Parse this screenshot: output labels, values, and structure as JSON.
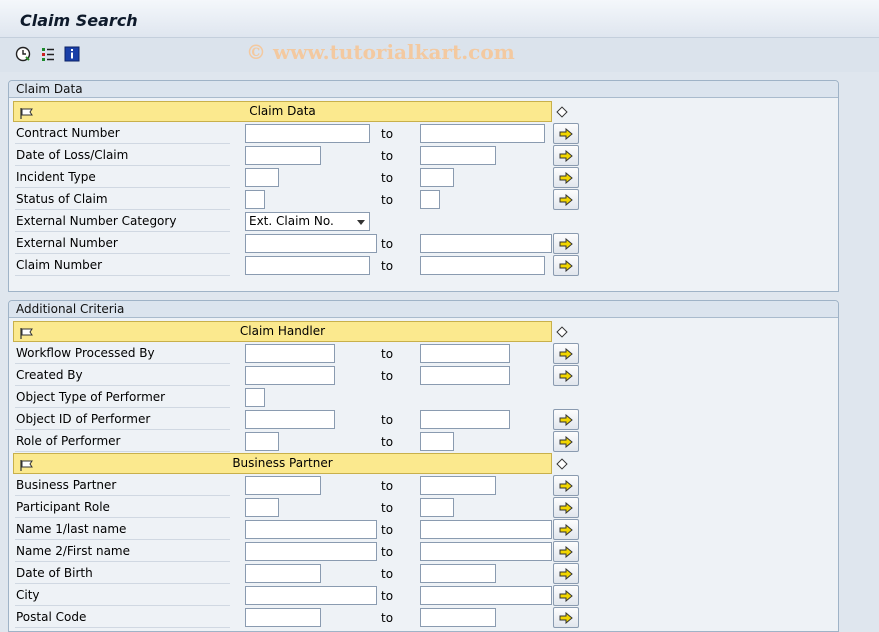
{
  "app": {
    "title": "Claim Search",
    "watermark": "© www.tutorialkart.com"
  },
  "toolbar": {
    "icons": [
      "execute-clock-icon",
      "selection-options-icon",
      "info-icon"
    ]
  },
  "sections": {
    "claim_data": {
      "title": "Claim Data",
      "block_title": "Claim Data",
      "rows": [
        {
          "label": "Contract Number"
        },
        {
          "label": "Date of Loss/Claim"
        },
        {
          "label": "Incident Type"
        },
        {
          "label": "Status of Claim"
        },
        {
          "label": "External Number Category",
          "value": "Ext. Claim No."
        },
        {
          "label": "External Number"
        },
        {
          "label": "Claim Number"
        }
      ]
    },
    "additional": {
      "title": "Additional Criteria",
      "handler_block_title": "Claim Handler",
      "handler_rows": [
        {
          "label": "Workflow Processed By"
        },
        {
          "label": "Created By"
        },
        {
          "label": "Object Type of Performer"
        },
        {
          "label": "Object ID of Performer"
        },
        {
          "label": "Role of Performer"
        }
      ],
      "bp_block_title": "Business Partner",
      "bp_rows": [
        {
          "label": "Business Partner"
        },
        {
          "label": "Participant Role"
        },
        {
          "label": "Name 1/last name"
        },
        {
          "label": "Name 2/First name"
        },
        {
          "label": "Date of Birth"
        },
        {
          "label": "City"
        },
        {
          "label": "Postal Code"
        }
      ]
    }
  },
  "common": {
    "to_label": "to"
  },
  "colors": {
    "block_header": "#fbe98e",
    "arrow": "#f2d600"
  }
}
